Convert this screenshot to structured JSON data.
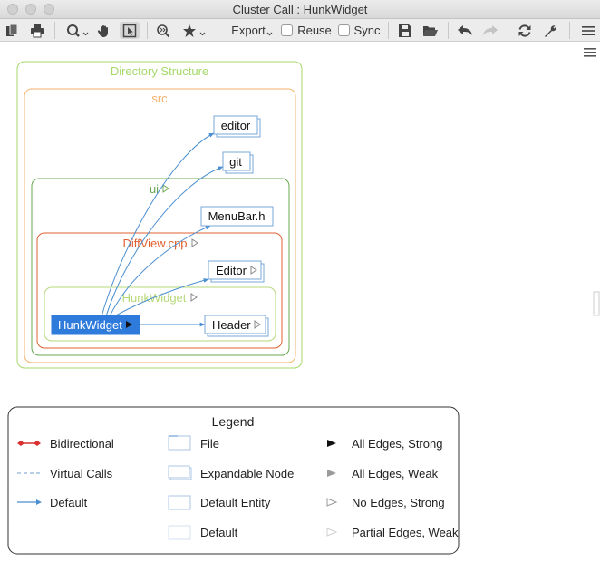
{
  "window": {
    "title": "Cluster Call : HunkWidget"
  },
  "toolbar": {
    "export_label": "Export",
    "reuse_label": "Reuse",
    "sync_label": "Sync",
    "reuse_checked": false,
    "sync_checked": false
  },
  "graph": {
    "clusters": {
      "directory": "Directory Structure",
      "src": "src",
      "ui": "ui",
      "diffview": "DiffView.cpp",
      "hunkwidget": "HunkWidget"
    },
    "nodes": {
      "editor_file": "editor",
      "git_file": "git",
      "menubar": "MenuBar.h",
      "editor_class": "Editor",
      "header_class": "Header",
      "hunkwidget_node": "HunkWidget"
    }
  },
  "legend": {
    "title": "Legend",
    "edges": [
      "Bidirectional",
      "Virtual Calls",
      "Default"
    ],
    "nodes": [
      "File",
      "Expandable Node",
      "Default Entity",
      "Default"
    ],
    "markers": [
      "All Edges, Strong",
      "All Edges, Weak",
      "No Edges, Strong",
      "Partial Edges, Weak"
    ]
  },
  "colors": {
    "directory_border": "#a6d96a",
    "src_border": "#f6b26b",
    "ui_border": "#6aa84f",
    "diffview_border": "#e06030",
    "hunkwidget_border": "#b6d97a",
    "edge": "#4a8fd0",
    "selected_node": "#2f7bdc",
    "bidirectional": "#d9302f"
  }
}
